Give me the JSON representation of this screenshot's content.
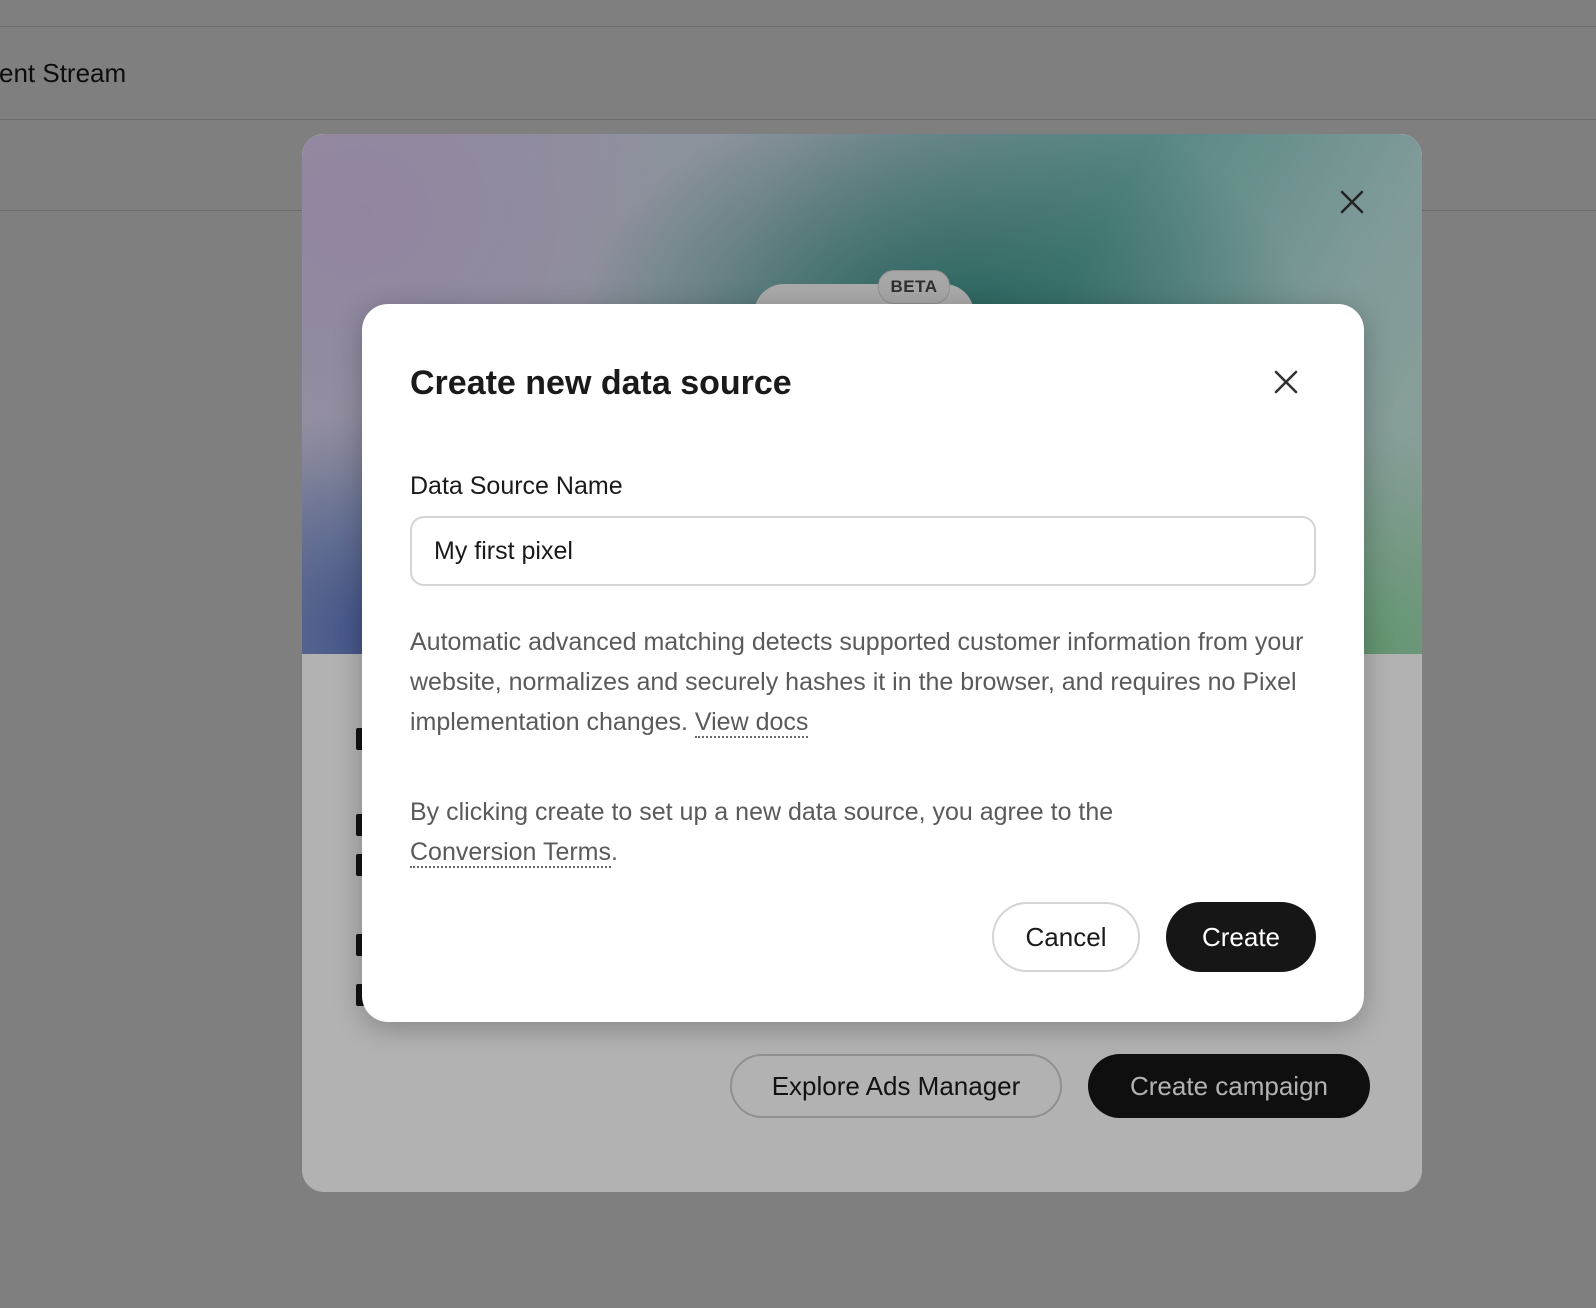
{
  "background": {
    "page_title": "vent Stream"
  },
  "outer_modal": {
    "badge": "BETA",
    "explore_button": "Explore Ads Manager",
    "create_campaign_button": "Create campaign",
    "close_icon": "close-icon"
  },
  "dialog": {
    "title": "Create new data source",
    "close_icon": "close-icon",
    "field_label": "Data Source Name",
    "field_value": "My first pixel",
    "help_text": "Automatic advanced matching detects supported customer information from your website, normalizes and securely hashes it in the browser, and requires no Pixel implementation changes.",
    "help_link": "View docs",
    "terms_text": "By clicking create to set up a new data source, you agree to the",
    "terms_link": "Conversion Terms",
    "terms_suffix": ".",
    "cancel_button": "Cancel",
    "create_button": "Create"
  },
  "colors": {
    "primary_button": "#161616",
    "overlay": "#808080"
  }
}
